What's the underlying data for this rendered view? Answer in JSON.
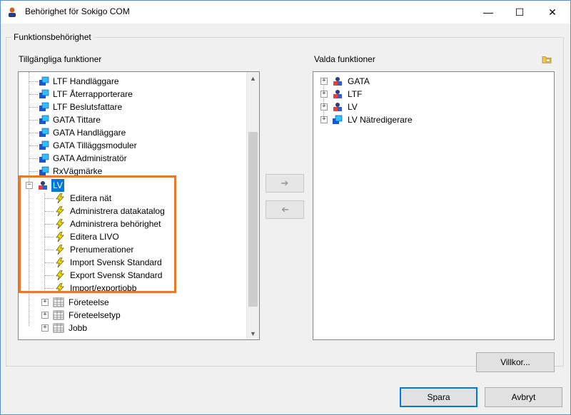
{
  "window": {
    "title": "Behörighet för Sokigo COM"
  },
  "titlebar_buttons": {
    "minimize": "—",
    "maximize": "☐",
    "close": "✕"
  },
  "group_label": "Funktionsbehörighet",
  "left": {
    "label": "Tillgängliga funktioner",
    "items": [
      {
        "text": "LTF Handläggare"
      },
      {
        "text": "LTF Återrapporterare"
      },
      {
        "text": "LTF Beslutsfattare"
      },
      {
        "text": "GATA Tittare"
      },
      {
        "text": "GATA Handläggare"
      },
      {
        "text": "GATA Tilläggsmoduler"
      },
      {
        "text": "GATA Administratör"
      },
      {
        "text": "RxVägmärke"
      },
      {
        "text": "LV"
      },
      {
        "text": "Editera nät"
      },
      {
        "text": "Administrera datakatalog"
      },
      {
        "text": "Administrera behörighet"
      },
      {
        "text": "Editera LIVO"
      },
      {
        "text": "Prenumerationer"
      },
      {
        "text": "Import Svensk Standard"
      },
      {
        "text": "Export Svensk Standard"
      },
      {
        "text": "Import/exportjobb"
      },
      {
        "text": "Företeelse"
      },
      {
        "text": "Företeelsetyp"
      },
      {
        "text": "Jobb"
      }
    ]
  },
  "right": {
    "label": "Valda funktioner",
    "items": [
      {
        "text": "GATA"
      },
      {
        "text": "LTF"
      },
      {
        "text": "LV"
      },
      {
        "text": "LV Nätredigerare"
      }
    ]
  },
  "buttons": {
    "add": "➔",
    "remove": "➔",
    "villkor": "Villkor...",
    "spara": "Spara",
    "avbryt": "Avbryt"
  },
  "icons": {
    "user": "user-icon",
    "role": "role-icon",
    "func": "lightning-icon",
    "table": "table-icon"
  },
  "colors": {
    "selection": "#0078d7",
    "highlight_border": "#e8792b"
  }
}
